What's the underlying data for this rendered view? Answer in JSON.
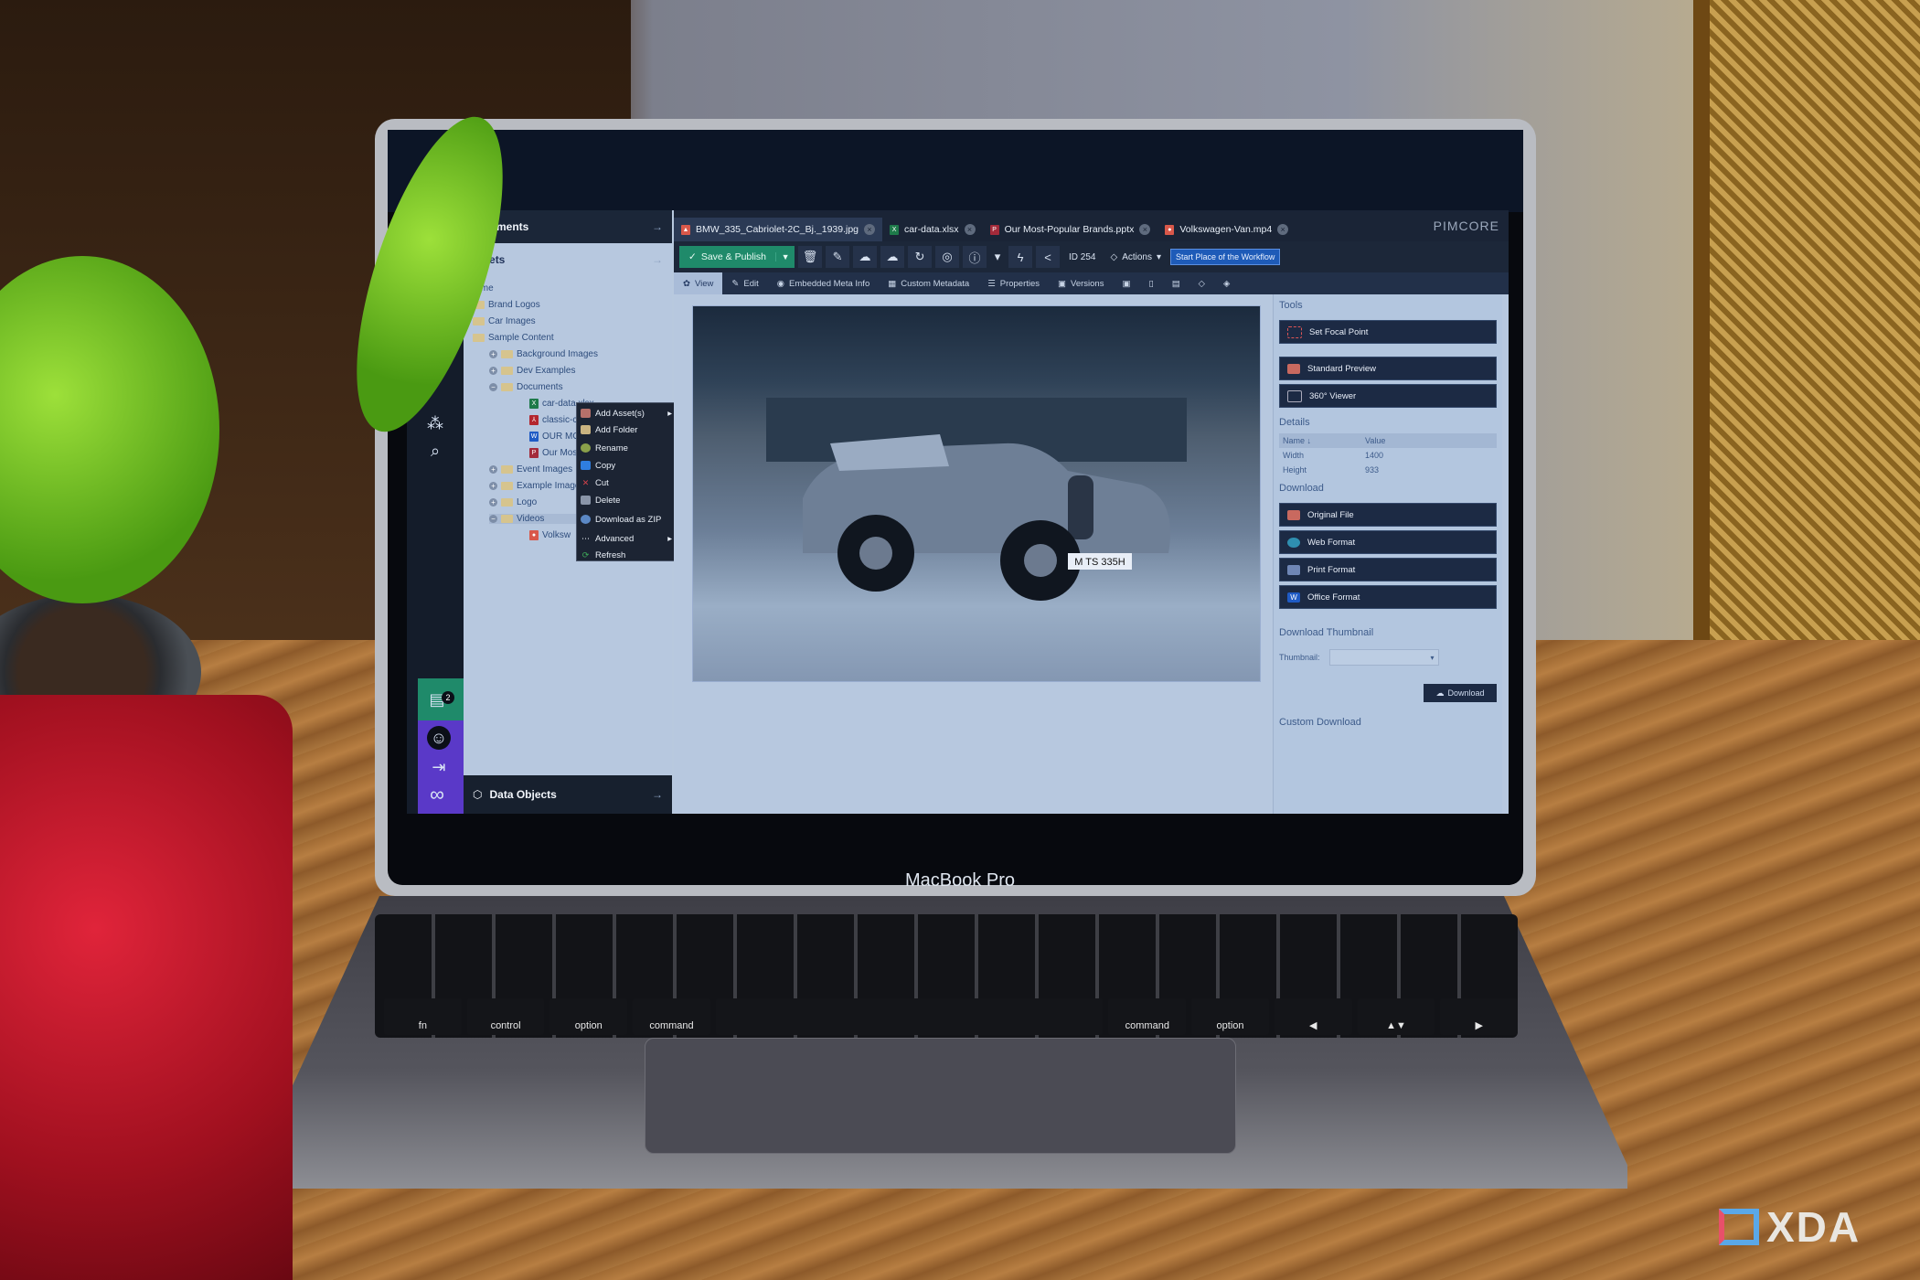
{
  "window": {
    "app_logo": "PIMCORE",
    "tabs": [
      {
        "label": "BMW_335_Cabriolet-2C_Bj._1939.jpg",
        "icon": "image-icon",
        "active": true
      },
      {
        "label": "car-data.xlsx",
        "icon": "excel-icon",
        "active": false
      },
      {
        "label": "Our Most-Popular Brands.pptx",
        "icon": "powerpoint-icon",
        "active": false
      },
      {
        "label": "Volkswagen-Van.mp4",
        "icon": "video-icon",
        "active": false
      }
    ]
  },
  "rail": {
    "notifications_count": "2"
  },
  "tree": {
    "documents_header": "Documents",
    "assets_header": "Assets",
    "data_objects_header": "Data Objects",
    "items": [
      {
        "label": "Home",
        "type": "root"
      },
      {
        "label": "Brand Logos",
        "type": "folder"
      },
      {
        "label": "Car Images",
        "type": "folder"
      },
      {
        "label": "Sample Content",
        "type": "folder"
      },
      {
        "label": "Background Images",
        "type": "folder",
        "toggle": "+"
      },
      {
        "label": "Dev Examples",
        "type": "folder",
        "toggle": "+"
      },
      {
        "label": "Documents",
        "type": "folder",
        "toggle": "−"
      },
      {
        "label": "car-data.xlsx",
        "type": "xlsx"
      },
      {
        "label": "classic-car-2016-3857.pdf",
        "type": "pdf"
      },
      {
        "label": "OUR MOST POPULAR BRANI",
        "type": "docx"
      },
      {
        "label": "Our Most Popular Brands.pp",
        "type": "pptx"
      },
      {
        "label": "Event Images",
        "type": "folder",
        "toggle": "+"
      },
      {
        "label": "Example Images",
        "type": "folder",
        "toggle": "+"
      },
      {
        "label": "Logo",
        "type": "folder",
        "toggle": "+"
      },
      {
        "label": "Videos",
        "type": "folder",
        "toggle": "−"
      },
      {
        "label": "Volksw",
        "type": "video"
      }
    ]
  },
  "context_menu": {
    "items": [
      {
        "label": "Add Asset(s)",
        "icon": "add-asset-icon",
        "submenu": true
      },
      {
        "label": "Add Folder",
        "icon": "add-folder-icon"
      },
      {
        "label": "Rename",
        "icon": "rename-icon"
      },
      {
        "label": "Copy",
        "icon": "copy-icon"
      },
      {
        "label": "Cut",
        "icon": "cut-icon"
      },
      {
        "label": "Delete",
        "icon": "delete-icon"
      },
      {
        "label": "Download as ZIP",
        "icon": "download-zip-icon"
      },
      {
        "label": "Advanced",
        "icon": "more-icon",
        "submenu": true
      },
      {
        "label": "Refresh",
        "icon": "refresh-icon"
      }
    ]
  },
  "toolbar": {
    "save_publish": "Save & Publish",
    "id_label": "ID 254",
    "actions_label": "Actions",
    "workflow_label": "Start Place of the Workflow"
  },
  "subtabs": [
    {
      "label": "View",
      "active": true
    },
    {
      "label": "Edit"
    },
    {
      "label": "Embedded Meta Info"
    },
    {
      "label": "Custom Metadata"
    },
    {
      "label": "Properties"
    },
    {
      "label": "Versions"
    }
  ],
  "viewer": {
    "license_plate": "M TS 335H"
  },
  "sidebar": {
    "tools_title": "Tools",
    "set_focal_point": "Set Focal Point",
    "standard_preview": "Standard Preview",
    "viewer_360": "360° Viewer",
    "details_title": "Details",
    "details_headers": {
      "name": "Name",
      "value": "Value"
    },
    "details_rows": [
      {
        "name": "Width",
        "value": "1400"
      },
      {
        "name": "Height",
        "value": "933"
      }
    ],
    "download_title": "Download",
    "download_buttons": [
      "Original File",
      "Web Format",
      "Print Format",
      "Office Format"
    ],
    "download_thumbnail_title": "Download Thumbnail",
    "thumbnail_label": "Thumbnail:",
    "thumbnail_value": "",
    "download_button": "Download",
    "custom_download_title": "Custom Download"
  },
  "hardware": {
    "laptop_label": "MacBook Pro",
    "keys_bottom_row": [
      "fn",
      "control",
      "option",
      "command",
      "",
      "command",
      "option",
      "◀",
      "▲▼",
      "▶"
    ]
  },
  "watermark": "XDA"
}
